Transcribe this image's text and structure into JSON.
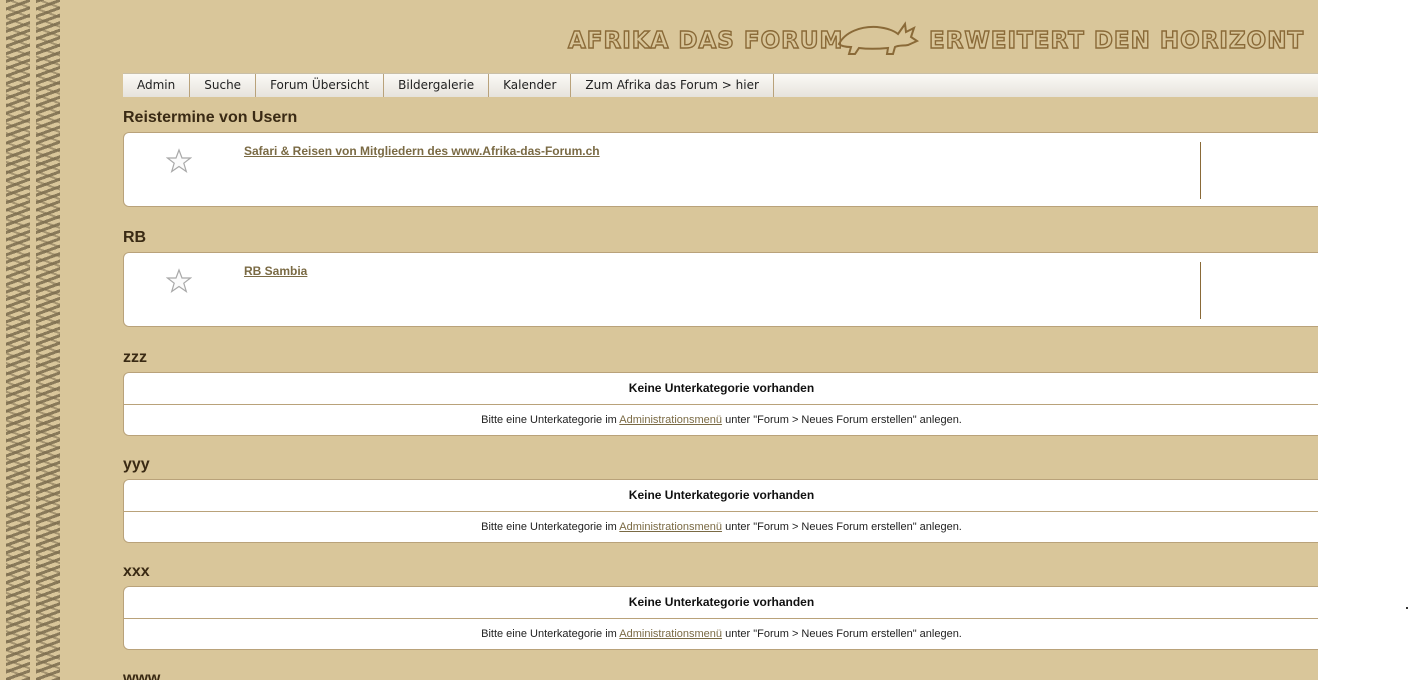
{
  "colors": {
    "page_bg": "#d9c69a",
    "border": "#b9a27a",
    "link": "#7a6a44",
    "banner_outline": "#8a6a38"
  },
  "banner": {
    "left_text": "AFRIKA DAS FORUM",
    "right_text": "ERWEITERT DEN HORIZONT",
    "emblem_icon": "rhino-icon"
  },
  "nav": {
    "items": [
      "Admin",
      "Suche",
      "Forum Übersicht",
      "Bildergalerie",
      "Kalender",
      "Zum Afrika das Forum > hier"
    ]
  },
  "categories": [
    {
      "title": "Reistermine von Usern",
      "forum_link": "Safari & Reisen von Mitgliedern des www.Afrika-das-Forum.ch",
      "icon": "star-icon"
    },
    {
      "title": "RB",
      "forum_link": "RB Sambia",
      "icon": "star-icon"
    },
    {
      "title": "zzz",
      "empty_heading": "Keine Unterkategorie vorhanden",
      "empty_prefix": "Bitte eine Unterkategorie im",
      "empty_link": "Administrationsmenü",
      "empty_suffix": "unter \"Forum > Neues Forum erstellen\" anlegen."
    },
    {
      "title": "yyy",
      "empty_heading": "Keine Unterkategorie vorhanden",
      "empty_prefix": "Bitte eine Unterkategorie im",
      "empty_link": "Administrationsmenü",
      "empty_suffix": "unter \"Forum > Neues Forum erstellen\" anlegen."
    },
    {
      "title": "xxx",
      "empty_heading": "Keine Unterkategorie vorhanden",
      "empty_prefix": "Bitte eine Unterkategorie im",
      "empty_link": "Administrationsmenü",
      "empty_suffix": "unter \"Forum > Neues Forum erstellen\" anlegen."
    },
    {
      "title": "www"
    }
  ]
}
